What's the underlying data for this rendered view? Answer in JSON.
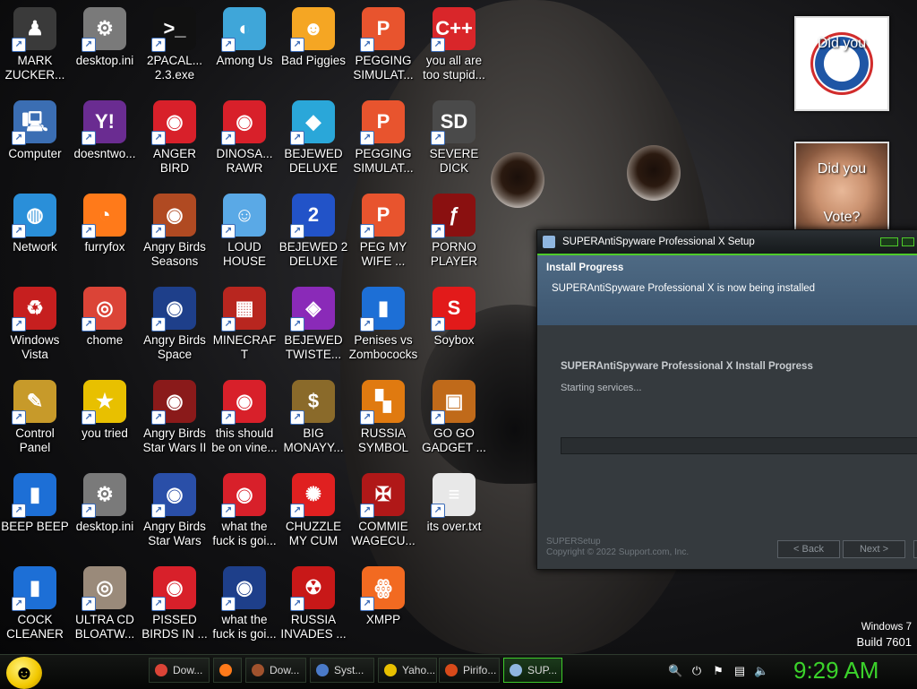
{
  "desktop_icons": [
    {
      "label": "MARK ZUCKER...",
      "icon": "dark-figure-icon",
      "color": "#3a3a3a",
      "glyph": "♟"
    },
    {
      "label": "desktop.ini",
      "icon": "config-file-icon",
      "color": "#7a7a7a",
      "glyph": "⚙"
    },
    {
      "label": "2PACAL... 2.3.exe",
      "icon": "terminal-icon",
      "color": "#111111",
      "glyph": ">_"
    },
    {
      "label": "Among Us",
      "icon": "among-us-icon",
      "color": "#3fa6d9",
      "glyph": "◐"
    },
    {
      "label": "Bad Piggies",
      "icon": "bad-piggies-icon",
      "color": "#f5a623",
      "glyph": "☻"
    },
    {
      "label": "PEGGING SIMULAT...",
      "icon": "pegging-icon",
      "color": "#e8542e",
      "glyph": "P"
    },
    {
      "label": "you all are too stupid...",
      "icon": "devcpp-icon",
      "color": "#d9262a",
      "glyph": "C++"
    },
    {
      "label": "Computer",
      "icon": "computer-icon",
      "color": "#3b6eb3",
      "glyph": "🖳"
    },
    {
      "label": "doesntwo...",
      "icon": "yahoo-messenger-icon",
      "color": "#6a2c91",
      "glyph": "Y!"
    },
    {
      "label": "ANGER BIRD",
      "icon": "angry-birds-icon",
      "color": "#d8202a",
      "glyph": "◉"
    },
    {
      "label": "DINOSA... RAWR",
      "icon": "angry-birds-icon",
      "color": "#d8202a",
      "glyph": "◉"
    },
    {
      "label": "BEJEWED DELUXE",
      "icon": "bejeweled-icon",
      "color": "#2aa7d9",
      "glyph": "◆"
    },
    {
      "label": "PEGGING SIMULAT...",
      "icon": "pegging-icon",
      "color": "#e8542e",
      "glyph": "P"
    },
    {
      "label": "SEVERE DICK",
      "icon": "sd-gear-icon",
      "color": "#4a4a4a",
      "glyph": "SD"
    },
    {
      "label": "Network",
      "icon": "network-globe-icon",
      "color": "#2a8fd9",
      "glyph": "◍"
    },
    {
      "label": "furryfox",
      "icon": "firefox-icon",
      "color": "#ff7a1a",
      "glyph": "◔"
    },
    {
      "label": "Angry Birds Seasons",
      "icon": "angry-birds-seasons-icon",
      "color": "#b04a22",
      "glyph": "◉"
    },
    {
      "label": "LOUD HOUSE",
      "icon": "loud-house-icon",
      "color": "#5aa9e6",
      "glyph": "☺"
    },
    {
      "label": "BEJEWED 2 DELUXE",
      "icon": "bejeweled-2-icon",
      "color": "#2253c8",
      "glyph": "2"
    },
    {
      "label": "PEG MY WIFE ...",
      "icon": "pegging-icon",
      "color": "#e8542e",
      "glyph": "P"
    },
    {
      "label": "PORNO PLAYER",
      "icon": "flash-player-icon",
      "color": "#8a1010",
      "glyph": "ƒ"
    },
    {
      "label": "Windows Vista",
      "icon": "recycle-bin-icon",
      "color": "#c61f1f",
      "glyph": "♻"
    },
    {
      "label": "chome",
      "icon": "chrome-icon",
      "color": "#db4437",
      "glyph": "◎"
    },
    {
      "label": "Angry Birds Space",
      "icon": "angry-birds-space-icon",
      "color": "#1e3f8a",
      "glyph": "◉"
    },
    {
      "label": "MINECRAFT",
      "icon": "minecraft-icon",
      "color": "#b8261f",
      "glyph": "▦"
    },
    {
      "label": "BEJEWED TWISTE...",
      "icon": "bejeweled-twist-icon",
      "color": "#8a2ab8",
      "glyph": "◈"
    },
    {
      "label": "Penises vs Zombococks",
      "icon": "blue-file-icon",
      "color": "#1d6fd6",
      "glyph": "▮"
    },
    {
      "label": "Soybox",
      "icon": "soybox-icon",
      "color": "#e21a1a",
      "glyph": "S"
    },
    {
      "label": "Control Panel",
      "icon": "control-panel-icon",
      "color": "#c79a2a",
      "glyph": "✎"
    },
    {
      "label": "you tried",
      "icon": "gold-star-icon",
      "color": "#e8c000",
      "glyph": "★"
    },
    {
      "label": "Angry Birds Star Wars II",
      "icon": "angry-birds-star-wars-icon",
      "color": "#8a1a1a",
      "glyph": "◉"
    },
    {
      "label": "this should be on vine...",
      "icon": "angry-birds-icon",
      "color": "#d8202a",
      "glyph": "◉"
    },
    {
      "label": "BIG MONAYY...",
      "icon": "money-bag-icon",
      "color": "#8a6a2a",
      "glyph": "$"
    },
    {
      "label": "RUSSIA SYMBOL",
      "icon": "orange-blocks-icon",
      "color": "#e07a10",
      "glyph": "▚"
    },
    {
      "label": "GO GO GADGET ...",
      "icon": "briefcase-icon",
      "color": "#c06a1a",
      "glyph": "▣"
    },
    {
      "label": "BEEP BEEP",
      "icon": "blue-file-icon",
      "color": "#1d6fd6",
      "glyph": "▮"
    },
    {
      "label": "desktop.ini",
      "icon": "config-file-icon",
      "color": "#7a7a7a",
      "glyph": "⚙"
    },
    {
      "label": "Angry Birds Star Wars",
      "icon": "angry-birds-star-wars-icon",
      "color": "#2a4fa8",
      "glyph": "◉"
    },
    {
      "label": "what the fuck is goi...",
      "icon": "angry-birds-icon",
      "color": "#d8202a",
      "glyph": "◉"
    },
    {
      "label": "CHUZZLE MY CUM",
      "icon": "chuzzle-icon",
      "color": "#e02020",
      "glyph": "✺"
    },
    {
      "label": "COMMIE WAGECU...",
      "icon": "winged-emblem-icon",
      "color": "#b01818",
      "glyph": "✠"
    },
    {
      "label": "its over.txt",
      "icon": "text-document-icon",
      "color": "#e8e8e8",
      "glyph": "≡"
    },
    {
      "label": "COCK CLEANER",
      "icon": "blue-file-icon",
      "color": "#1d6fd6",
      "glyph": "▮"
    },
    {
      "label": "ULTRA CD BLOATW...",
      "icon": "cd-disc-icon",
      "color": "#9a8a7a",
      "glyph": "◎"
    },
    {
      "label": "PISSED BIRDS IN ...",
      "icon": "angry-birds-icon",
      "color": "#d8202a",
      "glyph": "◉"
    },
    {
      "label": "what the fuck is goi...",
      "icon": "angry-birds-space-icon",
      "color": "#1e3f8a",
      "glyph": "◉"
    },
    {
      "label": "RUSSIA INVADES ...",
      "icon": "radiation-icon",
      "color": "#c81818",
      "glyph": "☢"
    },
    {
      "label": "XMPP",
      "icon": "xampp-icon",
      "color": "#f26a21",
      "glyph": "ꙮ"
    }
  ],
  "gadgets": [
    {
      "text_top": "Did you",
      "text_bottom": "",
      "icon": "obama-logo-icon"
    },
    {
      "text_top": "Did you",
      "text_bottom": "Vote?",
      "icon": "portrait-photo-icon"
    }
  ],
  "installer": {
    "title": "SUPERAntiSpyware Professional X Setup",
    "header_title": "Install Progress",
    "header_subtitle": "SUPERAntiSpyware Professional X is now being installed",
    "body_title": "SUPERAntiSpyware Professional X Install Progress",
    "status": "Starting services...",
    "progress_fraction": 0,
    "footer_brand": "SUPERSetup",
    "footer_copyright": "Copyright © 2022 Support.com, Inc.",
    "back_label": "< Back",
    "next_label": "Next >"
  },
  "watermark": {
    "line1": "Windows 7",
    "line2": "Build 7601"
  },
  "taskbar": {
    "start_icon": "smiley-start-icon",
    "buttons": [
      {
        "label": "Dow...",
        "icon": "chrome-icon",
        "color": "#db4437",
        "active": false
      },
      {
        "label": "",
        "icon": "firefox-icon",
        "color": "#ff7a1a",
        "active": false
      },
      {
        "label": "Dow...",
        "icon": "download-icon",
        "color": "#a0522d",
        "active": false
      },
      {
        "label": "Syst...",
        "icon": "system-icon",
        "color": "#4a7ac8",
        "active": false
      },
      {
        "label": "Yaho...",
        "icon": "yahoo-icon",
        "color": "#e8c000",
        "active": false
      },
      {
        "label": "Pirifo...",
        "icon": "piriform-icon",
        "color": "#d84a1a",
        "active": false
      },
      {
        "label": "SUP...",
        "icon": "superantispyware-icon",
        "color": "#8fb6e0",
        "active": true
      }
    ],
    "tray": [
      "search-icon",
      "power-icon",
      "flag-icon",
      "network-icon",
      "volume-icon"
    ],
    "clock": "9:29 AM"
  }
}
